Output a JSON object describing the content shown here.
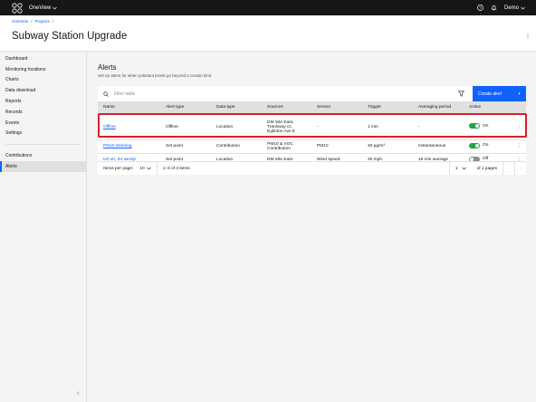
{
  "topbar": {
    "app_name": "OneView",
    "user_name": "Demo"
  },
  "header": {
    "breadcrumb": [
      "OneView",
      "Projects"
    ],
    "title": "Subway Station Upgrade"
  },
  "sidebar": {
    "items": [
      {
        "label": "Dashboard"
      },
      {
        "label": "Monitoring locations"
      },
      {
        "label": "Charts"
      },
      {
        "label": "Data download"
      },
      {
        "label": "Reports"
      },
      {
        "label": "Records"
      },
      {
        "label": "Events"
      },
      {
        "label": "Settings"
      }
    ],
    "secondary": [
      {
        "label": "Contributions"
      },
      {
        "label": "Alerts"
      }
    ]
  },
  "main": {
    "title": "Alerts",
    "subtitle": "Set up alerts for when pollutant levels go beyond a certain limit.",
    "filter_placeholder": "Filter table",
    "create_label": "Create alert",
    "columns": [
      "Name",
      "Alert type",
      "Data type",
      "Sources",
      "Sensor",
      "Trigger",
      "Averaging period",
      "Active"
    ],
    "rows": [
      {
        "name": "Offline",
        "alert_type": "Offline",
        "data_type": "Location",
        "sources": [
          "DM Site East,",
          "Transway Cr,",
          "Eglinton Ave E"
        ],
        "sensor": "-",
        "trigger": "1 min",
        "averaging": "-",
        "active": "On"
      },
      {
        "name": "PM10 Warning",
        "alert_type": "Set point",
        "data_type": "Contribution",
        "sources": [
          "PM10 & VOC",
          "Contribution"
        ],
        "sensor": "PM10",
        "trigger": "40 µg/m³",
        "averaging": "Instantaneous",
        "active": "On"
      },
      {
        "name": "Uh-oh, it's windy!",
        "alert_type": "Set point",
        "data_type": "Location",
        "sources": [
          "DM Site East"
        ],
        "sensor": "Wind speed",
        "trigger": "30 mph",
        "averaging": "15 min average",
        "active": "Off"
      }
    ],
    "pagination": {
      "items_per_page_label": "Items per page:",
      "items_per_page": "10",
      "range": "1–3 of 3 items",
      "page": "1",
      "of_pages": "of 1 pages"
    }
  },
  "colors": {
    "accent": "#0f62fe",
    "topbar": "#161616",
    "toggle_on": "#24a148",
    "highlight": "#da1e28"
  }
}
